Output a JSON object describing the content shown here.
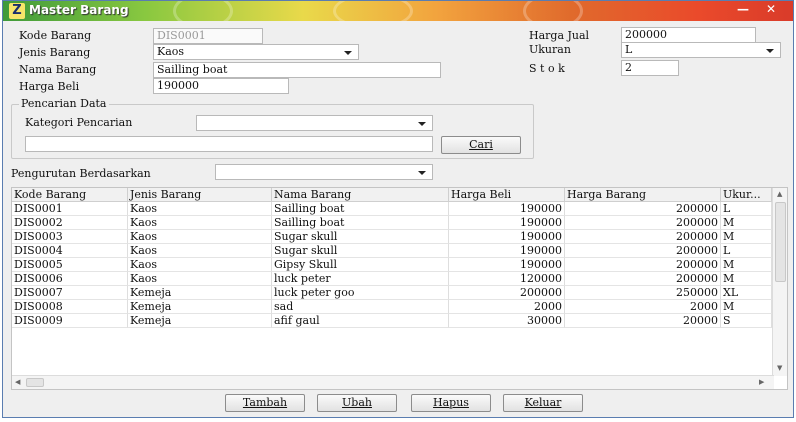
{
  "window": {
    "title": "Master Barang",
    "icon": "app-logo-icon",
    "minimize": "—",
    "close": "✕"
  },
  "form": {
    "kode_barang": {
      "label": "Kode Barang",
      "value": "DIS0001"
    },
    "jenis_barang": {
      "label": "Jenis Barang",
      "value": "Kaos"
    },
    "nama_barang": {
      "label": "Nama Barang",
      "value": "Sailling boat"
    },
    "harga_beli": {
      "label": "Harga Beli",
      "value": "190000"
    },
    "harga_jual": {
      "label": "Harga Jual",
      "value": "200000"
    },
    "ukuran": {
      "label": "Ukuran",
      "value": "L"
    },
    "stok": {
      "label": "S t o k",
      "value": "2"
    }
  },
  "search": {
    "group_title": "Pencarian Data",
    "kategori_label": "Kategori Pencarian",
    "kategori_value": "",
    "keyword_value": "",
    "cari_button": "Cari"
  },
  "sort": {
    "label": "Pengurutan Berdasarkan",
    "value": ""
  },
  "table": {
    "columns": [
      "Kode Barang",
      "Jenis Barang",
      "Nama Barang",
      "Harga Beli",
      "Harga Barang",
      "Ukur..."
    ],
    "rows": [
      [
        "DIS0001",
        "Kaos",
        "Sailling boat",
        "190000",
        "200000",
        "L"
      ],
      [
        "DIS0002",
        "Kaos",
        "Sailling boat",
        "190000",
        "200000",
        "M"
      ],
      [
        "DIS0003",
        "Kaos",
        "Sugar skull",
        "190000",
        "200000",
        "M"
      ],
      [
        "DIS0004",
        "Kaos",
        "Sugar skull",
        "190000",
        "200000",
        "L"
      ],
      [
        "DIS0005",
        "Kaos",
        "Gipsy Skull",
        "190000",
        "200000",
        "M"
      ],
      [
        "DIS0006",
        "Kaos",
        "luck peter",
        "120000",
        "200000",
        "M"
      ],
      [
        "DIS0007",
        "Kemeja",
        "luck peter goo",
        "200000",
        "250000",
        "XL"
      ],
      [
        "DIS0008",
        "Kemeja",
        "sad",
        "2000",
        "2000",
        "M"
      ],
      [
        "DIS0009",
        "Kemeja",
        "afif gaul",
        "30000",
        "20000",
        "S"
      ]
    ]
  },
  "buttons": {
    "tambah": "Tambah",
    "ubah": "Ubah",
    "hapus": "Hapus",
    "keluar": "Keluar"
  }
}
